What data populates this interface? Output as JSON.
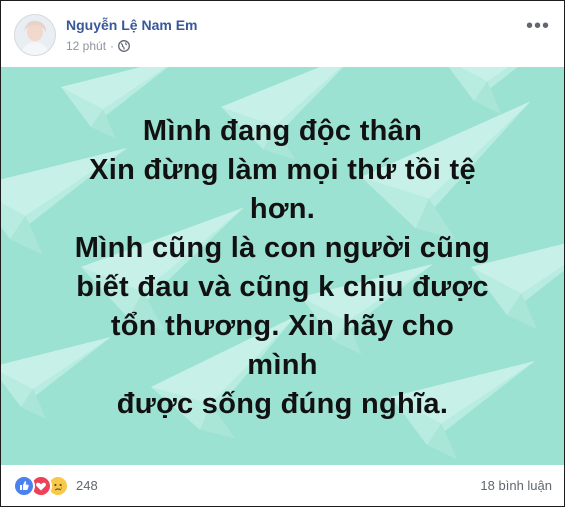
{
  "post": {
    "author": "Nguyễn Lệ Nam Em",
    "time": "12 phút",
    "privacy_icon": "globe-icon",
    "more_icon": "more-options-icon",
    "background_color": "#9ce2d3",
    "text_lines": [
      "Mình đang độc thân",
      "Xin đừng làm mọi thứ tồi tệ",
      "hơn.",
      "Mình cũng là con người cũng",
      "biết đau và cũng k chịu được",
      "tổn thương. Xin hãy cho mình",
      "được sống đúng nghĩa."
    ]
  },
  "footer": {
    "reaction_icons": [
      "like-icon",
      "love-icon",
      "sad-icon"
    ],
    "reaction_count": "248",
    "comments": "18 bình luận"
  }
}
